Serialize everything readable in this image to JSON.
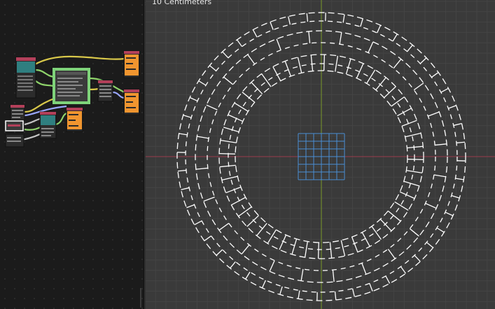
{
  "viewport": {
    "scale_label": "10 Centimeters",
    "grid_color": "#444444",
    "axis_x_color": "#9b3c4c",
    "axis_y_color": "#7a9a2a",
    "wire_color": "#ffffff",
    "selection_color": "#4a8fd4"
  },
  "node_editor": {
    "background": "#1b1b1b",
    "node_colors": {
      "teal": "#2f7f80",
      "orange": "#f0952f",
      "red": "#b3405a",
      "green_frame": "#7fd37a",
      "gray": "#505050"
    },
    "link_colors": [
      "#8fd46b",
      "#d9c84a",
      "#9aa7ff",
      "#c5c5c5"
    ]
  }
}
